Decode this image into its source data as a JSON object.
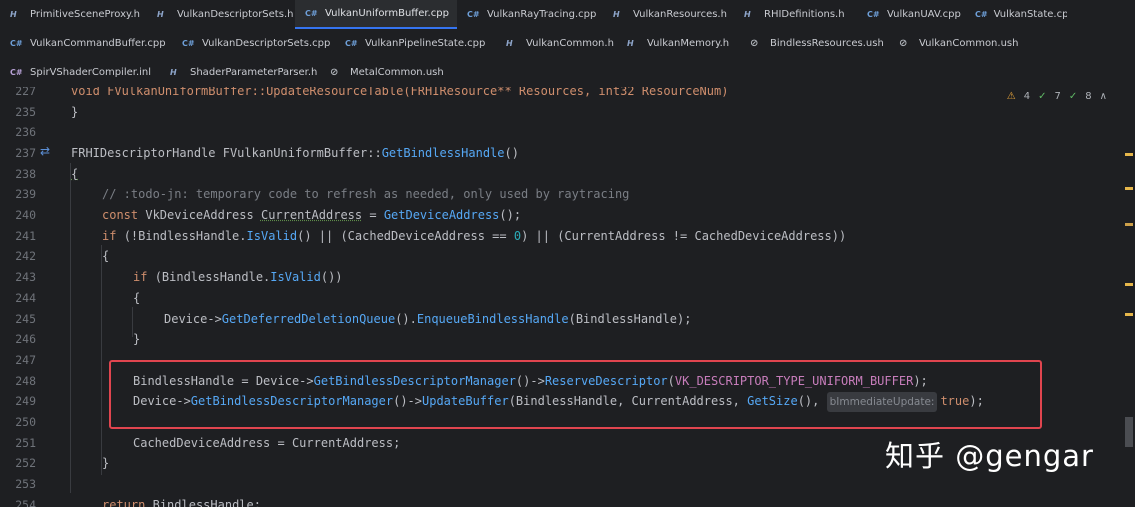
{
  "tabs_row1": [
    {
      "icon": "H",
      "label": "PrimitiveSceneProxy.h"
    },
    {
      "icon": "H",
      "label": "VulkanDescriptorSets.h"
    },
    {
      "icon": "C#",
      "label": "VulkanUniformBuffer.cpp",
      "active": true
    },
    {
      "icon": "C#",
      "label": "VulkanRayTracing.cpp"
    },
    {
      "icon": "H",
      "label": "VulkanResources.h"
    },
    {
      "icon": "H",
      "label": "RHIDefinitions.h"
    },
    {
      "icon": "C#",
      "label": "VulkanUAV.cpp"
    },
    {
      "icon": "C#",
      "label": "VulkanState.cpp"
    }
  ],
  "tabs_row2": [
    {
      "icon": "C#",
      "label": "VulkanCommandBuffer.cpp"
    },
    {
      "icon": "C#",
      "label": "VulkanDescriptorSets.cpp"
    },
    {
      "icon": "C#",
      "label": "VulkanPipelineState.cpp"
    },
    {
      "icon": "H",
      "label": "VulkanCommon.h"
    },
    {
      "icon": "H",
      "label": "VulkanMemory.h"
    },
    {
      "icon": "⊘",
      "label": "BindlessResources.ush"
    },
    {
      "icon": "⊘",
      "label": "VulkanCommon.ush"
    }
  ],
  "tabs_row3": [
    {
      "icon": "C#",
      "label": "SpirVShaderCompiler.inl"
    },
    {
      "icon": "H",
      "label": "ShaderParameterParser.h"
    },
    {
      "icon": "⊘",
      "label": "MetalCommon.ush"
    }
  ],
  "inspections": {
    "warnings": "4",
    "weak": "7",
    "typos": "8"
  },
  "line_numbers": [
    "227",
    "235",
    "236",
    "237",
    "238",
    "239",
    "240",
    "241",
    "242",
    "243",
    "244",
    "245",
    "246",
    "247",
    "248",
    "249",
    "250",
    "251",
    "252",
    "253",
    "254"
  ],
  "code": {
    "l227": "void FVulkanUniformBuffer::UpdateResourceTable(FRHIResource** Resources, int32 ResourceNum)",
    "l235": "}",
    "l237_type": "FRHIDescriptorHandle",
    "l237_class": "FVulkanUniformBuffer",
    "l237_fn": "GetBindlessHandle",
    "l238": "{",
    "l239": "// :todo-jn: temporary code to refresh as needed, only used by raytracing",
    "l240_a": "const",
    "l240_b": "VkDeviceAddress",
    "l240_c": "CurrentAddress",
    "l240_d": "GetDeviceAddress",
    "l241_if": "if",
    "l241_a": "(!BindlessHandle.",
    "l241_b": "IsValid",
    "l241_c": "() || (CachedDeviceAddress == ",
    "l241_d": "0",
    "l241_e": ") || (CurrentAddress != CachedDeviceAddress))",
    "l242": "{",
    "l243_if": "if",
    "l243_a": "(BindlessHandle.",
    "l243_b": "IsValid",
    "l243_c": "())",
    "l244": "{",
    "l245_a": "Device->",
    "l245_b": "GetDeferredDeletionQueue",
    "l245_c": "().",
    "l245_d": "EnqueueBindlessHandle",
    "l245_e": "(BindlessHandle);",
    "l246": "}",
    "l248_a": "BindlessHandle = Device->",
    "l248_b": "GetBindlessDescriptorManager",
    "l248_c": "()->",
    "l248_d": "ReserveDescriptor",
    "l248_e": "(",
    "l248_f": "VK_DESCRIPTOR_TYPE_UNIFORM_BUFFER",
    "l248_g": ");",
    "l249_a": "Device->",
    "l249_b": "GetBindlessDescriptorManager",
    "l249_c": "()->",
    "l249_d": "UpdateBuffer",
    "l249_e": "(BindlessHandle, CurrentAddress, ",
    "l249_f": "GetSize",
    "l249_g": "(), ",
    "l249_hint": "bImmediateUpdate:",
    "l249_h": "true",
    "l249_i": ");",
    "l251": "CachedDeviceAddress = CurrentAddress;",
    "l252": "}",
    "l254_kw": "return",
    "l254_rest": "BindlessHandle;"
  },
  "watermark": "知乎 @gengar"
}
